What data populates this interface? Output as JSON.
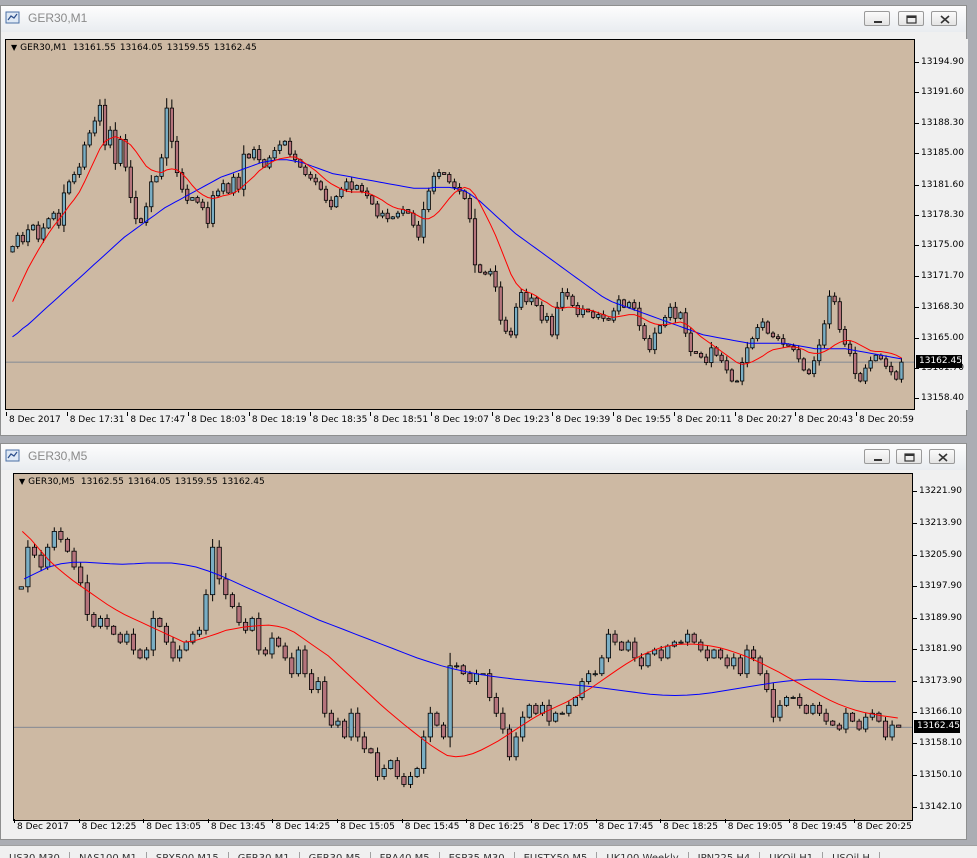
{
  "windows": [
    {
      "id": "m1",
      "title": "GER30,M1",
      "header": {
        "symbol": "GER30,M1",
        "open": "13161.55",
        "high": "13164.05",
        "low": "13159.55",
        "close": "13162.45"
      },
      "controls": [
        "minimize",
        "restore",
        "close"
      ],
      "price_label": "13162.45",
      "colors": {
        "background": "#cdb9a3",
        "bull": "#7aaec4",
        "bear": "#b5747c",
        "fast_ma": "#ff0000",
        "slow_ma": "#0000ff",
        "bid_line": "#6b7a8f"
      },
      "chart_data": {
        "type": "candlestick",
        "y_ticks": [
          "13194.90",
          "13191.60",
          "13188.30",
          "13185.00",
          "13181.60",
          "13178.30",
          "13175.00",
          "13171.70",
          "13168.30",
          "13165.00",
          "13161.70",
          "13158.40"
        ],
        "x_ticks": [
          "8 Dec 2017",
          "8 Dec 17:31",
          "8 Dec 17:47",
          "8 Dec 18:03",
          "8 Dec 18:19",
          "8 Dec 18:35",
          "8 Dec 18:51",
          "8 Dec 19:07",
          "8 Dec 19:23",
          "8 Dec 19:39",
          "8 Dec 19:55",
          "8 Dec 20:11",
          "8 Dec 20:27",
          "8 Dec 20:43",
          "8 Dec 20:59"
        ],
        "ylim": [
          13157.8,
          13196.3
        ],
        "bid": 13162.45,
        "close": [
          13175.0,
          13176.2,
          13175.5,
          13176.8,
          13177.3,
          13175.8,
          13177.0,
          13178.0,
          13178.6,
          13177.3,
          13180.8,
          13182.0,
          13182.8,
          13183.6,
          13186.0,
          13187.3,
          13188.6,
          13190.3,
          13186.0,
          13187.6,
          13184.0,
          13186.6,
          13183.6,
          13180.3,
          13178.0,
          13177.6,
          13179.3,
          13182.0,
          13182.6,
          13184.6,
          13190.0,
          13186.4,
          13183.0,
          13181.2,
          13180.0,
          13180.3,
          13179.8,
          13179.2,
          13177.5,
          13180.5,
          13181.0,
          13181.8,
          13180.8,
          13182.5,
          13181.2,
          13185.0,
          13184.6,
          13185.5,
          13184.4,
          13183.6,
          13184.6,
          13185.4,
          13186.0,
          13186.4,
          13185.0,
          13184.4,
          13183.6,
          13182.8,
          13182.4,
          13182.0,
          13181.2,
          13180.0,
          13179.3,
          13180.4,
          13181.2,
          13182.0,
          13181.2,
          13181.6,
          13181.0,
          13180.5,
          13179.6,
          13178.3,
          13178.6,
          13178.0,
          13178.2,
          13178.6,
          13179.0,
          13178.6,
          13177.3,
          13176.0,
          13179.0,
          13181.0,
          13182.6,
          13183.0,
          13182.8,
          13182.0,
          13181.4,
          13181.0,
          13180.2,
          13178.0,
          13173.0,
          13172.2,
          13172.0,
          13172.3,
          13170.6,
          13167.0,
          13165.8,
          13165.4,
          13168.4,
          13170.0,
          13169.0,
          13169.4,
          13168.6,
          13167.0,
          13167.4,
          13165.4,
          13168.4,
          13170.0,
          13169.6,
          13168.6,
          13167.6,
          13168.2,
          13167.9,
          13167.3,
          13167.6,
          13167.2,
          13167.0,
          13168.0,
          13169.2,
          13168.4,
          13168.9,
          13168.3,
          13166.4,
          13165.0,
          13163.8,
          13165.6,
          13166.4,
          13167.3,
          13168.4,
          13167.2,
          13167.8,
          13165.6,
          13163.6,
          13163.4,
          13163.0,
          13162.4,
          13164.0,
          13163.2,
          13162.6,
          13161.6,
          13160.4,
          13160.4,
          13162.4,
          13164.0,
          13165.0,
          13166.2,
          13166.8,
          13165.6,
          13165.2,
          13165.0,
          13164.4,
          13164.2,
          13163.8,
          13162.8,
          13161.6,
          13161.2,
          13162.6,
          13164.3,
          13166.6,
          13169.6,
          13169.0,
          13166.0,
          13164.4,
          13163.4,
          13161.2,
          13160.4,
          13161.8,
          13162.6,
          13163.2,
          13162.8,
          13162.0,
          13161.4,
          13160.6,
          13162.45
        ],
        "fast_ma": [
          13169.0,
          13170.2,
          13171.4,
          13172.6,
          13173.6,
          13174.6,
          13175.5,
          13176.4,
          13177.2,
          13177.9,
          13178.6,
          13179.4,
          13180.1,
          13180.9,
          13182.0,
          13183.2,
          13184.4,
          13185.6,
          13186.4,
          13186.7,
          13186.9,
          13186.7,
          13186.4,
          13186.0,
          13185.3,
          13184.5,
          13183.7,
          13183.3,
          13183.1,
          13183.0,
          13183.3,
          13183.4,
          13183.3,
          13182.9,
          13182.3,
          13181.6,
          13181.0,
          13180.6,
          13180.3,
          13180.2,
          13180.3,
          13180.5,
          13180.6,
          13180.8,
          13181.1,
          13181.6,
          13182.1,
          13182.6,
          13183.2,
          13183.6,
          13184.0,
          13184.3,
          13184.5,
          13184.6,
          13184.7,
          13184.7,
          13184.4,
          13184.0,
          13183.6,
          13183.2,
          13182.7,
          13182.2,
          13181.8,
          13181.5,
          13181.2,
          13181.0,
          13180.9,
          13180.9,
          13180.9,
          13180.8,
          13180.6,
          13180.3,
          13180.0,
          13179.6,
          13179.3,
          13179.1,
          13179.0,
          13178.8,
          13178.6,
          13178.3,
          13178.0,
          13178.0,
          13178.3,
          13178.8,
          13179.5,
          13180.2,
          13180.8,
          13181.2,
          13181.4,
          13181.2,
          13180.6,
          13179.6,
          13178.5,
          13177.4,
          13176.2,
          13174.8,
          13173.4,
          13172.0,
          13171.0,
          13170.4,
          13170.1,
          13169.9,
          13169.6,
          13169.2,
          13168.9,
          13168.5,
          13168.3,
          13168.3,
          13168.4,
          13168.4,
          13168.3,
          13168.2,
          13168.1,
          13168.0,
          13167.8,
          13167.6,
          13167.4,
          13167.3,
          13167.4,
          13167.5,
          13167.6,
          13167.6,
          13167.4,
          13167.1,
          13166.8,
          13166.6,
          13166.5,
          13166.5,
          13166.6,
          13166.7,
          13166.8,
          13166.6,
          13166.2,
          13165.7,
          13165.2,
          13164.8,
          13164.4,
          13164.0,
          13163.6,
          13163.2,
          13162.8,
          13162.4,
          13162.2,
          13162.3,
          13162.5,
          13162.8,
          13163.1,
          13163.5,
          13163.8,
          13163.9,
          13164.0,
          13164.1,
          13164.1,
          13164.0,
          13163.8,
          13163.5,
          13163.4,
          13163.4,
          13163.6,
          13163.9,
          13164.3,
          13164.6,
          13164.8,
          13164.8,
          13164.6,
          13164.3,
          13164.0,
          13163.7,
          13163.6,
          13163.6,
          13163.5,
          13163.4,
          13163.2,
          13162.9
        ],
        "slow_ma": [
          13165.2,
          13165.6,
          13166.1,
          13166.5,
          13167.0,
          13167.5,
          13168.0,
          13168.5,
          13169.0,
          13169.5,
          13170.0,
          13170.5,
          13171.0,
          13171.5,
          13172.0,
          13172.5,
          13173.0,
          13173.5,
          13174.0,
          13174.5,
          13175.0,
          13175.5,
          13176.0,
          13176.4,
          13176.8,
          13177.2,
          13177.6,
          13178.0,
          13178.4,
          13178.8,
          13179.2,
          13179.5,
          13179.8,
          13180.1,
          13180.4,
          13180.7,
          13181.0,
          13181.3,
          13181.6,
          13181.9,
          13182.2,
          13182.5,
          13182.7,
          13182.9,
          13183.1,
          13183.3,
          13183.5,
          13183.7,
          13183.9,
          13184.1,
          13184.2,
          13184.3,
          13184.4,
          13184.4,
          13184.4,
          13184.3,
          13184.2,
          13184.1,
          13183.9,
          13183.7,
          13183.5,
          13183.3,
          13183.1,
          13182.9,
          13182.8,
          13182.7,
          13182.6,
          13182.5,
          13182.4,
          13182.3,
          13182.2,
          13182.1,
          13182.0,
          13181.9,
          13181.8,
          13181.7,
          13181.6,
          13181.5,
          13181.4,
          13181.3,
          13181.3,
          13181.3,
          13181.3,
          13181.4,
          13181.4,
          13181.4,
          13181.4,
          13181.3,
          13181.2,
          13181.0,
          13180.7,
          13180.3,
          13179.9,
          13179.4,
          13178.9,
          13178.4,
          13177.9,
          13177.4,
          13176.9,
          13176.4,
          13176.0,
          13175.6,
          13175.2,
          13174.8,
          13174.4,
          13174.0,
          13173.6,
          13173.2,
          13172.8,
          13172.4,
          13172.0,
          13171.6,
          13171.2,
          13170.8,
          13170.4,
          13170.0,
          13169.6,
          13169.3,
          13169.0,
          13168.8,
          13168.6,
          13168.4,
          13168.2,
          13168.0,
          13167.8,
          13167.6,
          13167.4,
          13167.2,
          13167.0,
          13166.8,
          13166.6,
          13166.4,
          13166.2,
          13166.0,
          13165.8,
          13165.6,
          13165.4,
          13165.3,
          13165.2,
          13165.1,
          13165.0,
          13164.9,
          13164.8,
          13164.7,
          13164.6,
          13164.5,
          13164.5,
          13164.5,
          13164.5,
          13164.5,
          13164.5,
          13164.5,
          13164.5,
          13164.4,
          13164.3,
          13164.2,
          13164.1,
          13164.0,
          13163.9,
          13163.9,
          13163.9,
          13163.9,
          13163.9,
          13163.9,
          13163.9,
          13163.8,
          13163.7,
          13163.6,
          13163.5,
          13163.4,
          13163.3,
          13163.2,
          13163.1,
          13163.0,
          13162.9,
          13162.8
        ]
      }
    },
    {
      "id": "m5",
      "title": "GER30,M5",
      "header": {
        "symbol": "GER30,M5",
        "open": "13162.55",
        "high": "13164.05",
        "low": "13159.55",
        "close": "13162.45"
      },
      "controls": [
        "minimize",
        "restore",
        "close"
      ],
      "price_label": "13162.45",
      "colors": {
        "background": "#cdb9a3",
        "bull": "#7aaec4",
        "bear": "#b5747c",
        "fast_ma": "#ff0000",
        "slow_ma": "#0000ff",
        "bid_line": "#6b7a8f"
      },
      "chart_data": {
        "type": "candlestick",
        "y_ticks": [
          "13221.90",
          "13213.90",
          "13205.90",
          "13197.90",
          "13189.90",
          "13181.90",
          "13173.90",
          "13166.10",
          "13158.10",
          "13150.10",
          "13142.10"
        ],
        "x_ticks": [
          "8 Dec 2017",
          "8 Dec 12:25",
          "8 Dec 13:05",
          "8 Dec 13:45",
          "8 Dec 14:25",
          "8 Dec 15:05",
          "8 Dec 15:45",
          "8 Dec 16:25",
          "8 Dec 17:05",
          "8 Dec 17:45",
          "8 Dec 18:25",
          "8 Dec 19:05",
          "8 Dec 19:45",
          "8 Dec 20:25"
        ],
        "ylim": [
          13140.0,
          13224.0
        ],
        "bid": 13162.45,
        "close": [
          13198.0,
          13208.0,
          13206.0,
          13203.0,
          13208.0,
          13212.0,
          13210.0,
          13207.0,
          13203.0,
          13199.0,
          13191.0,
          13188.0,
          13190.0,
          13188.0,
          13186.0,
          13184.0,
          13186.0,
          13182.0,
          13180.0,
          13182.0,
          13190.0,
          13188.0,
          13184.0,
          13180.0,
          13182.0,
          13184.0,
          13186.0,
          13187.0,
          13196.0,
          13208.0,
          13200.0,
          13196.0,
          13193.0,
          13189.0,
          13187.0,
          13190.0,
          13182.0,
          13181.0,
          13185.0,
          13183.0,
          13180.0,
          13176.0,
          13182.0,
          13176.0,
          13172.0,
          13174.0,
          13166.0,
          13163.0,
          13164.0,
          13160.0,
          13166.0,
          13160.0,
          13157.0,
          13156.0,
          13150.0,
          13152.0,
          13154.0,
          13150.0,
          13148.0,
          13150.0,
          13152.0,
          13160.0,
          13166.0,
          13163.0,
          13160.0,
          13178.0,
          13178.0,
          13176.0,
          13174.0,
          13176.0,
          13176.0,
          13170.0,
          13166.0,
          13162.0,
          13155.0,
          13160.0,
          13165.0,
          13168.0,
          13166.0,
          13168.0,
          13164.0,
          13166.0,
          13166.0,
          13168.0,
          13170.0,
          13174.0,
          13176.0,
          13176.0,
          13180.0,
          13186.0,
          13184.0,
          13182.0,
          13184.0,
          13180.0,
          13178.0,
          13181.0,
          13182.0,
          13180.0,
          13183.0,
          13184.0,
          13184.0,
          13186.0,
          13184.0,
          13182.0,
          13180.0,
          13182.0,
          13180.0,
          13178.0,
          13180.0,
          13176.0,
          13182.0,
          13180.0,
          13176.0,
          13172.0,
          13165.0,
          13168.0,
          13170.0,
          13170.0,
          13168.0,
          13166.0,
          13168.0,
          13166.0,
          13164.0,
          13163.0,
          13162.0,
          13166.0,
          13164.0,
          13162.0,
          13165.0,
          13166.0,
          13164.0,
          13160.0,
          13163.0,
          13162.45
        ],
        "fast_ma": [
          13212.0,
          13210.0,
          13207.5,
          13205.0,
          13203.0,
          13201.2,
          13199.5,
          13198.0,
          13196.5,
          13195.0,
          13193.5,
          13192.2,
          13191.0,
          13190.0,
          13189.0,
          13188.0,
          13187.0,
          13186.0,
          13185.0,
          13184.0,
          13184.2,
          13184.8,
          13185.5,
          13186.2,
          13187.0,
          13187.4,
          13187.8,
          13188.0,
          13188.2,
          13188.3,
          13188.0,
          13187.5,
          13186.5,
          13185.0,
          13183.5,
          13182.0,
          13180.5,
          13178.5,
          13176.5,
          13174.5,
          13172.5,
          13170.5,
          13168.5,
          13166.6,
          13164.8,
          13163.0,
          13161.3,
          13159.6,
          13158.0,
          13156.6,
          13155.3,
          13155.0,
          13155.2,
          13155.8,
          13156.7,
          13157.8,
          13159.0,
          13160.4,
          13161.8,
          13163.2,
          13164.6,
          13165.8,
          13166.8,
          13167.8,
          13168.8,
          13170.0,
          13171.2,
          13172.5,
          13174.0,
          13175.5,
          13177.0,
          13178.4,
          13179.7,
          13180.8,
          13181.7,
          13182.5,
          13183.0,
          13183.4,
          13183.5,
          13183.5,
          13183.3,
          13183.0,
          13182.6,
          13182.0,
          13181.3,
          13180.5,
          13179.6,
          13178.6,
          13177.5,
          13176.4,
          13175.2,
          13174.0,
          13172.8,
          13171.6,
          13170.4,
          13169.3,
          13168.3,
          13167.5,
          13166.8,
          13166.2,
          13165.8,
          13165.4,
          13165.1,
          13164.8
        ],
        "slow_ma": [
          13200.0,
          13201.5,
          13203.0,
          13203.8,
          13204.2,
          13204.2,
          13204.0,
          13203.8,
          13203.7,
          13203.8,
          13204.0,
          13204.0,
          13204.0,
          13203.6,
          13203.0,
          13202.0,
          13200.8,
          13199.4,
          13198.0,
          13196.6,
          13195.2,
          13193.8,
          13192.4,
          13191.0,
          13189.6,
          13188.4,
          13187.2,
          13186.0,
          13184.8,
          13183.6,
          13182.4,
          13181.2,
          13180.0,
          13179.0,
          13178.0,
          13177.2,
          13176.5,
          13175.9,
          13175.4,
          13175.0,
          13174.6,
          13174.3,
          13174.0,
          13173.7,
          13173.4,
          13173.1,
          13172.8,
          13172.4,
          13172.0,
          13171.6,
          13171.2,
          13170.8,
          13170.6,
          13170.5,
          13170.6,
          13170.8,
          13171.2,
          13171.7,
          13172.2,
          13172.7,
          13173.2,
          13173.7,
          13174.1,
          13174.4,
          13174.6,
          13174.6,
          13174.5,
          13174.3,
          13174.1,
          13174.0,
          13174.0,
          13174.0
        ]
      }
    }
  ],
  "tabs": [
    "US30,M30",
    "NAS100,M1",
    "SPX500,M15",
    "GER30,M1",
    "GER30,M5",
    "FRA40,M5",
    "ESP35,M30",
    "EUSTX50,M5",
    "UK100,Weekly",
    "JPN225,H4",
    "UKOil,H1",
    "USOil,H"
  ]
}
